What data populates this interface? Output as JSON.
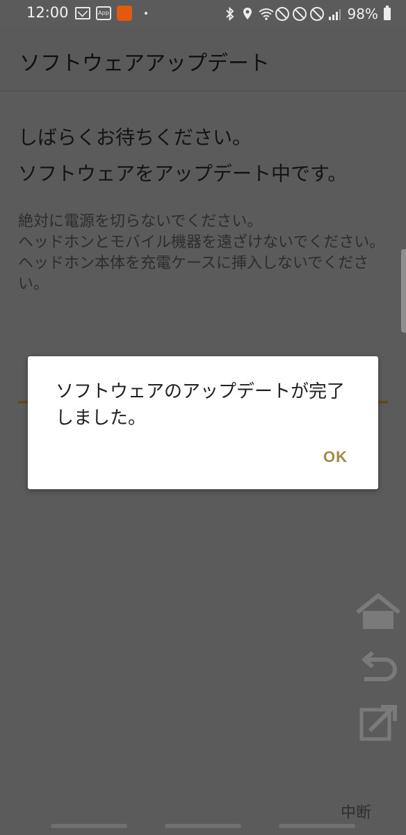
{
  "status": {
    "time": "12:00",
    "notification_icons": [
      "mail-icon",
      "app-icon",
      "app-orange-icon",
      "more-dot-icon"
    ],
    "system_icons": [
      "bluetooth-icon",
      "location-icon",
      "wifi-icon",
      "block-icon",
      "block-icon",
      "block-icon",
      "signal-icon"
    ],
    "battery": "98%",
    "app_icon_text": "App"
  },
  "appbar": {
    "title": "ソフトウェアアップデート"
  },
  "main": {
    "message_line1": "しばらくお待ちください。",
    "message_line2": "ソフトウェアをアップデート中です。",
    "warning_line1": "絶対に電源を切らないでください。",
    "warning_line2": "ヘッドホンとモバイル機器を遠ざけないでください。",
    "warning_line3": "ヘッドホン本体を充電ケースに挿入しないでください。"
  },
  "dialog": {
    "message": "ソフトウェアのアップデートが完了しました。",
    "ok_label": "OK"
  },
  "floating_buttons": [
    "home-icon",
    "back-icon",
    "share-icon"
  ],
  "footer": {
    "stop_label": "中断"
  },
  "colors": {
    "accent": "#a48b4a",
    "overlay": "#5b5b5b",
    "progress": "#5e4b1f"
  }
}
